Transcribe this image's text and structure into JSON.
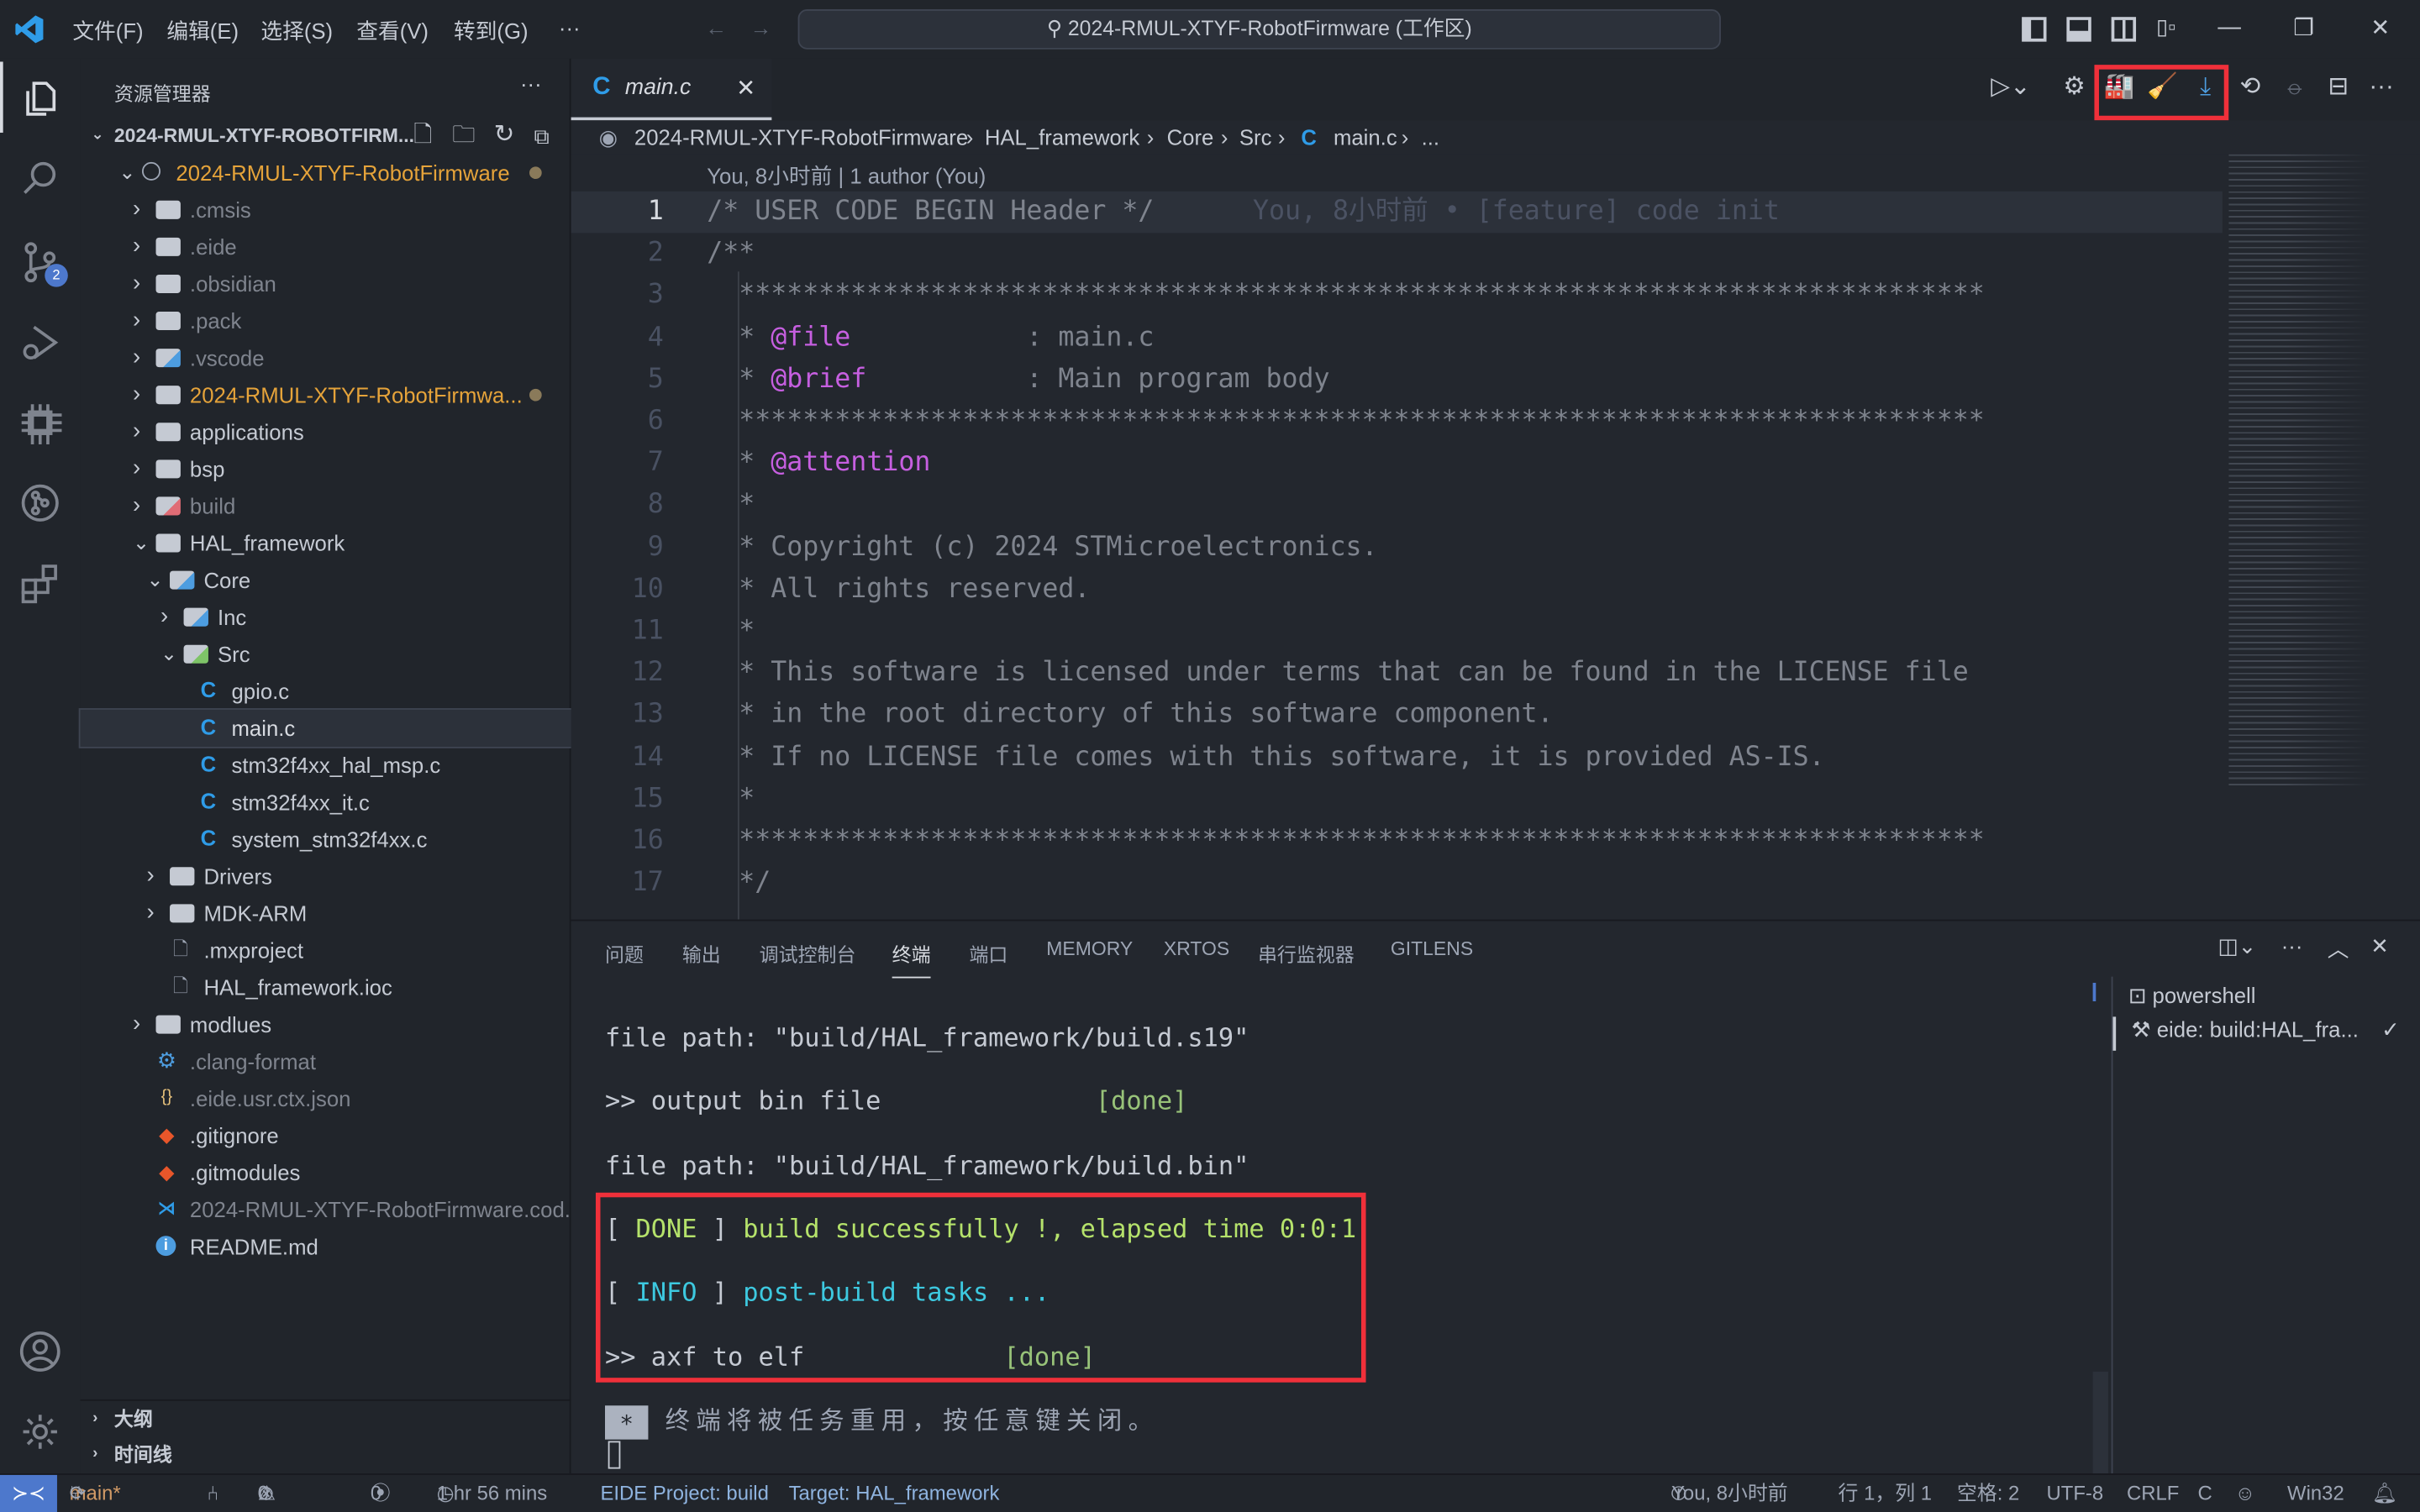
{
  "titlebar": {
    "menus": [
      "文件(F)",
      "编辑(E)",
      "选择(S)",
      "查看(V)",
      "转到(G)",
      "···"
    ],
    "command_center": "2024-RMUL-XTYF-RobotFirmware (工作区)"
  },
  "activity": {
    "source_control_badge": "2"
  },
  "sidebar": {
    "title": "资源管理器",
    "more": "···",
    "workspace": "2024-RMUL-XTYF-ROBOTFIRM...",
    "items": [
      {
        "label": "2024-RMUL-XTYF-RobotFirmware",
        "depth": 1,
        "kind": "root",
        "open": true,
        "color": "#e5a33a",
        "modified": true
      },
      {
        "label": ".cmsis",
        "depth": 2,
        "kind": "folder",
        "open": false,
        "color": "#7f848e"
      },
      {
        "label": ".eide",
        "depth": 2,
        "kind": "folder",
        "open": false,
        "color": "#7f848e"
      },
      {
        "label": ".obsidian",
        "depth": 2,
        "kind": "folder",
        "open": false,
        "color": "#7f848e"
      },
      {
        "label": ".pack",
        "depth": 2,
        "kind": "folder",
        "open": false,
        "color": "#7f848e"
      },
      {
        "label": ".vscode",
        "depth": 2,
        "kind": "vscode-folder",
        "open": false,
        "color": "#7f848e"
      },
      {
        "label": "2024-RMUL-XTYF-RobotFirmwa...",
        "depth": 2,
        "kind": "folder",
        "open": false,
        "color": "#e5a33a",
        "modified": true
      },
      {
        "label": "applications",
        "depth": 2,
        "kind": "folder",
        "open": false,
        "color": "#c5cad3"
      },
      {
        "label": "bsp",
        "depth": 2,
        "kind": "folder",
        "open": false,
        "color": "#c5cad3"
      },
      {
        "label": "build",
        "depth": 2,
        "kind": "build-folder",
        "open": false,
        "color": "#7f848e"
      },
      {
        "label": "HAL_framework",
        "depth": 2,
        "kind": "folder",
        "open": true,
        "color": "#c5cad3"
      },
      {
        "label": "Core",
        "depth": 3,
        "kind": "core-folder",
        "open": true,
        "color": "#c5cad3"
      },
      {
        "label": "Inc",
        "depth": 4,
        "kind": "inc-folder",
        "open": false,
        "color": "#c5cad3"
      },
      {
        "label": "Src",
        "depth": 4,
        "kind": "src-folder",
        "open": true,
        "color": "#c5cad3"
      },
      {
        "label": "gpio.c",
        "depth": 5,
        "kind": "c-file",
        "color": "#c5cad3"
      },
      {
        "label": "main.c",
        "depth": 5,
        "kind": "c-file",
        "color": "#d7dae0",
        "selected": true
      },
      {
        "label": "stm32f4xx_hal_msp.c",
        "depth": 5,
        "kind": "c-file",
        "color": "#c5cad3"
      },
      {
        "label": "stm32f4xx_it.c",
        "depth": 5,
        "kind": "c-file",
        "color": "#c5cad3"
      },
      {
        "label": "system_stm32f4xx.c",
        "depth": 5,
        "kind": "c-file",
        "color": "#c5cad3"
      },
      {
        "label": "Drivers",
        "depth": 3,
        "kind": "folder",
        "open": false,
        "color": "#c5cad3"
      },
      {
        "label": "MDK-ARM",
        "depth": 3,
        "kind": "folder",
        "open": false,
        "color": "#c5cad3"
      },
      {
        "label": ".mxproject",
        "depth": 3,
        "kind": "file",
        "color": "#c5cad3"
      },
      {
        "label": "HAL_framework.ioc",
        "depth": 3,
        "kind": "file",
        "color": "#c5cad3"
      },
      {
        "label": "modlues",
        "depth": 2,
        "kind": "folder",
        "open": false,
        "color": "#c5cad3"
      },
      {
        "label": ".clang-format",
        "depth": 2,
        "kind": "gear-file",
        "color": "#7f848e"
      },
      {
        "label": ".eide.usr.ctx.json",
        "depth": 2,
        "kind": "json-file",
        "color": "#7f848e"
      },
      {
        "label": ".gitignore",
        "depth": 2,
        "kind": "git-file",
        "color": "#c5cad3"
      },
      {
        "label": ".gitmodules",
        "depth": 2,
        "kind": "git-file",
        "color": "#c5cad3"
      },
      {
        "label": "2024-RMUL-XTYF-RobotFirmware.cod...",
        "depth": 2,
        "kind": "vscode-file",
        "color": "#7f848e"
      },
      {
        "label": "README.md",
        "depth": 2,
        "kind": "info-file",
        "color": "#c5cad3"
      }
    ],
    "outline": "大纲",
    "timeline": "时间线"
  },
  "editor": {
    "tab_label": "main.c",
    "breadcrumb": [
      "2024-RMUL-XTYF-RobotFirmware",
      "HAL_framework",
      "Core",
      "Src",
      "main.c",
      "..."
    ],
    "codelens": "You, 8小时前 | 1 author (You)",
    "blame": "You, 8小时前 • [feature] code init",
    "lines": [
      [
        {
          "t": "/* USER CODE BEGIN Header */"
        }
      ],
      [
        {
          "t": "/**"
        }
      ],
      [
        {
          "t": "  ******************************************************************************"
        }
      ],
      [
        {
          "t": "  * "
        },
        {
          "t": "@file",
          "c": "tag"
        },
        {
          "t": "           : main.c"
        }
      ],
      [
        {
          "t": "  * "
        },
        {
          "t": "@brief",
          "c": "tag"
        },
        {
          "t": "          : Main program body"
        }
      ],
      [
        {
          "t": "  ******************************************************************************"
        }
      ],
      [
        {
          "t": "  * "
        },
        {
          "t": "@attention",
          "c": "tag"
        }
      ],
      [
        {
          "t": "  *"
        }
      ],
      [
        {
          "t": "  * Copyright (c) 2024 STMicroelectronics."
        }
      ],
      [
        {
          "t": "  * All rights reserved."
        }
      ],
      [
        {
          "t": "  *"
        }
      ],
      [
        {
          "t": "  * This software is licensed under terms that can be found in the LICENSE file"
        }
      ],
      [
        {
          "t": "  * in the root directory of this software component."
        }
      ],
      [
        {
          "t": "  * If no LICENSE file comes with this software, it is provided AS-IS."
        }
      ],
      [
        {
          "t": "  *"
        }
      ],
      [
        {
          "t": "  ******************************************************************************"
        }
      ],
      [
        {
          "t": "  */"
        }
      ]
    ]
  },
  "panel": {
    "tabs": [
      "问题",
      "输出",
      "调试控制台",
      "终端",
      "端口",
      "MEMORY",
      "XRTOS",
      "串行监视器",
      "GITLENS"
    ],
    "active_tab": "终端",
    "terminal_lines": [
      [
        {
          "t": "file path: \"build/HAL_framework/build.s19\""
        }
      ],
      [
        {
          "t": ">> output bin file              "
        },
        {
          "t": "[done]",
          "c": "g"
        }
      ],
      [
        {
          "t": "file path: \"build/HAL_framework/build.bin\""
        }
      ],
      [
        {
          "t": "[ "
        },
        {
          "t": "DONE",
          "c": "lg"
        },
        {
          "t": " ] "
        },
        {
          "t": "build successfully !, elapsed time 0:0:1",
          "c": "lg"
        }
      ],
      [
        {
          "t": "[ "
        },
        {
          "t": "INFO",
          "c": "cy"
        },
        {
          "t": " ] "
        },
        {
          "t": "post-build tasks ...",
          "c": "cy"
        }
      ],
      [
        {
          "t": ">> axf to elf             "
        },
        {
          "t": "[done]",
          "c": "g"
        }
      ]
    ],
    "reuse_marker": "*",
    "reuse_message": "终端将被任务重用，按任意键关闭。",
    "terminals": [
      "powershell",
      "eide: build:HAL_fra..."
    ]
  },
  "statusbar": {
    "branch": "main*",
    "errors": "0",
    "warnings": "0",
    "ports": "0",
    "time": "1 hr 56 mins",
    "eide_project": "EIDE Project: build",
    "target": "Target: HAL_framework",
    "blame": "You, 8小时前",
    "position": "行 1，列 1",
    "spaces": "空格: 2",
    "encoding": "UTF-8",
    "eol": "CRLF",
    "language": "C",
    "platform": "Win32"
  },
  "colors": {
    "accent": "#4d78cc",
    "highlight_box": "#f0303a",
    "modified": "#e5a33a",
    "tag": "#c65fe0"
  }
}
